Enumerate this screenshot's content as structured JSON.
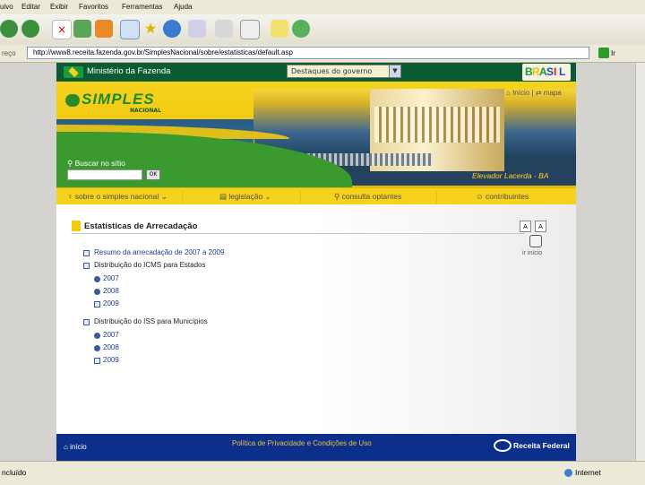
{
  "browser": {
    "menu": [
      "Arquivo",
      "Editar",
      "Exibir",
      "Favoritos",
      "Ferramentas",
      "Ajuda"
    ],
    "menu_visible": [
      "uivo",
      "Editar",
      "Exibir",
      "Favoritos",
      "Ferramentas",
      "Ajuda"
    ],
    "address_label": "reço",
    "url": "http://www8.receita.fazenda.gov.br/SimplesNacional/sobre/estatisticas/default.asp",
    "go_label": "Ir",
    "status_text": "ncluído",
    "status_zone": "Internet"
  },
  "govbar": {
    "title": "Ministério da Fazenda",
    "select_value": "Destaques do governo",
    "brand_letters": [
      "B",
      "R",
      "A",
      "S",
      "I",
      "L"
    ],
    "brand_colors": [
      "#1b9a3c",
      "#f2c200",
      "#1b9a3c",
      "#2a4ea8",
      "#d22",
      "#2a4ea8"
    ]
  },
  "header": {
    "logo_text": "SIMPLES",
    "logo_sub": "NACIONAL",
    "link_home": "Início",
    "link_sep": "|",
    "link_map": "mapa",
    "search_label": "Buscar no sítio",
    "search_button": "OK",
    "photo_caption": "Elevador Lacerda - BA"
  },
  "nav": {
    "items": [
      "sobre o simples nacional",
      "legislação",
      "consulta optantes",
      "contribuintes"
    ]
  },
  "content": {
    "section_title": "Estatísticas de Arrecadação",
    "tools": [
      "A",
      "A"
    ],
    "links": [
      {
        "label": "Resumo da arrecadação de 2007 a 2009"
      },
      {
        "label": "Distribuição do ICMS para Estados"
      },
      {
        "label": "2007"
      },
      {
        "label": "2008"
      },
      {
        "label": "2009"
      },
      {
        "label": "Distribuição do ISS para Municípios"
      },
      {
        "label": "2007"
      },
      {
        "label": "2008"
      },
      {
        "label": "2009"
      }
    ],
    "home_label": "ir início"
  },
  "footer": {
    "home": "início",
    "policy": "Política de Privacidade e Condições de Uso",
    "brand": "Receita Federal"
  },
  "colors": {
    "gov_green": "#0b5a32",
    "header_yellow": "#f0c60d",
    "footer_blue": "#0d2f8c",
    "link_blue": "#1a3c8a"
  }
}
